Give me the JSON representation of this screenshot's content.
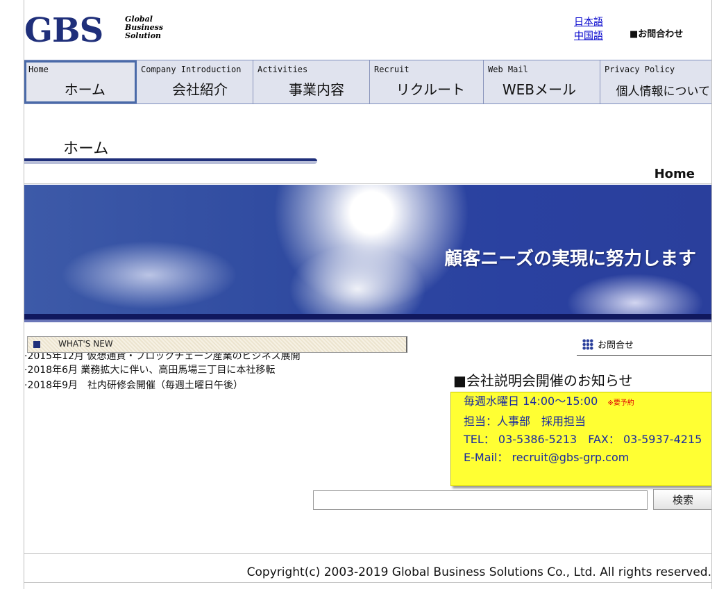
{
  "header": {
    "logo_mark": "GBS",
    "logo_lines": [
      "Global",
      "Business",
      "Solution"
    ],
    "lang_links": [
      "日本語",
      "中国語"
    ],
    "contact": "■お問合わせ"
  },
  "nav": {
    "tabs": [
      {
        "en": "Home",
        "jp": "ホーム",
        "active": true
      },
      {
        "en": "Company Introduction",
        "jp": "会社紹介"
      },
      {
        "en": "Activities",
        "jp": "事業内容"
      },
      {
        "en": "Recruit",
        "jp": "リクルート"
      },
      {
        "en": "Web Mail",
        "jp": "WEBメール"
      },
      {
        "en": "Privacy Policy",
        "jp": "個人情報について"
      }
    ]
  },
  "page": {
    "title": "ホーム",
    "breadcrumb_en": "Home"
  },
  "banner": {
    "text": "顧客ニーズの実現に努力します"
  },
  "news": {
    "label": "WHAT'S NEW",
    "items": [
      "·2015年12月 仮想通貨・ブロックチェーン産業のビジネス展開",
      "·2018年6月 業務拡大に伴い、高田馬場三丁目に本社移転",
      "·2018年9月　社内研修会開催（毎週土曜日午後）"
    ]
  },
  "side": {
    "contact_label": "お問合せ"
  },
  "notice": {
    "title": "■会社説明会開催のお知らせ",
    "schedule": "毎週水曜日 14:00～15:00",
    "reservation": "※要予約",
    "person": "担当：人事部　採用担当",
    "tel": "TEL： 03-5386-5213　FAX： 03-5937-4215",
    "email": "E-Mail： recruit@gbs-grp.com"
  },
  "search": {
    "value": "",
    "button": "検索"
  },
  "footer": {
    "copyright": "Copyright(c) 2003-2019 Global Business Solutions Co., Ltd. All rights reserved."
  },
  "colors": {
    "brand_navy": "#1f2f7a",
    "notice_yellow": "#ffff33",
    "notice_text": "#1a2aa0",
    "link": "#0000cc"
  }
}
